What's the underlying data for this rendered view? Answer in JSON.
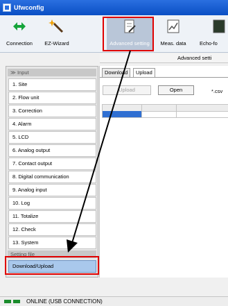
{
  "window": {
    "title": "Ufwconfig"
  },
  "toolbar": {
    "buttons": [
      {
        "label": "Connection",
        "icon": "connection-arrows-icon"
      },
      {
        "label": "EZ-Wizard",
        "icon": "wizard-wand-icon"
      },
      {
        "label": "Advanced setting",
        "icon": "document-edit-icon"
      },
      {
        "label": "Meas. data",
        "icon": "chart-icon"
      },
      {
        "label": "Echo-fo",
        "icon": "echo-icon"
      }
    ]
  },
  "subheader": {
    "text": "Advanced setti"
  },
  "sidebar": {
    "group_input": "Input",
    "items": [
      "1. Site",
      "2. Flow unit",
      "3. Correction",
      "4. Alarm",
      "5. LCD",
      "6. Analog output",
      "7. Contact output",
      "8. Digital communication",
      "9. Analog input",
      "10. Log",
      "11. Totalize",
      "12. Check",
      "13. System"
    ],
    "group_setting_file": "Setting file",
    "selected_item": "Download/Upload"
  },
  "panel": {
    "tabs": [
      "Download",
      "Upload"
    ],
    "upload_button": "Upload",
    "open_button": "Open",
    "extension": "*.csv"
  },
  "status": {
    "text": "ONLINE (USB CONNECTION)"
  },
  "colors": {
    "title_bar": "#0a4fc4",
    "highlight": "#e00000",
    "selected": "#a9c8ec",
    "status_led": "#1a8c2c"
  }
}
